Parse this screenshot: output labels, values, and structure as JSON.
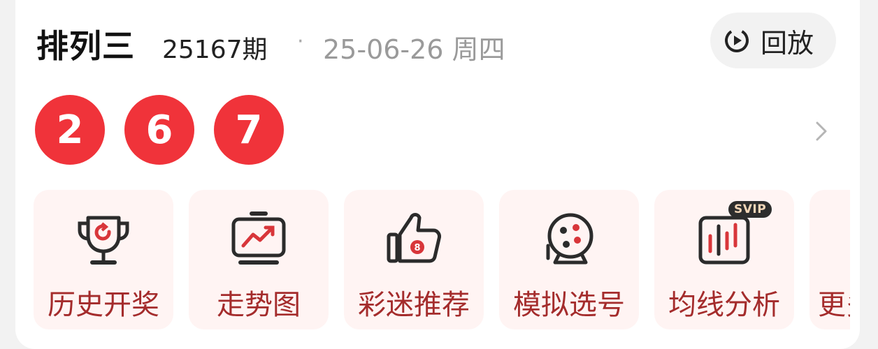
{
  "header": {
    "title": "排列三",
    "issue": "25167期",
    "separator": "·",
    "date": "25-06-26 周四",
    "replay_label": "回放"
  },
  "draw": {
    "numbers": [
      "2",
      "6",
      "7"
    ],
    "ball_color": "#f0333a"
  },
  "tiles": [
    {
      "label": "历史开奖",
      "icon": "trophy-icon"
    },
    {
      "label": "走势图",
      "icon": "trend-chart-icon"
    },
    {
      "label": "彩迷推荐",
      "icon": "thumbs-up-icon"
    },
    {
      "label": "模拟选号",
      "icon": "lottery-machine-icon"
    },
    {
      "label": "均线分析",
      "icon": "candlestick-chart-icon",
      "badge": "SVIP"
    },
    {
      "label": "更多",
      "icon": "more-icon"
    }
  ],
  "colors": {
    "tile_background": "#fff4f3",
    "tile_label": "#a42c2c",
    "icon_stroke": "#2b2b2b",
    "icon_accent": "#d8363a"
  }
}
